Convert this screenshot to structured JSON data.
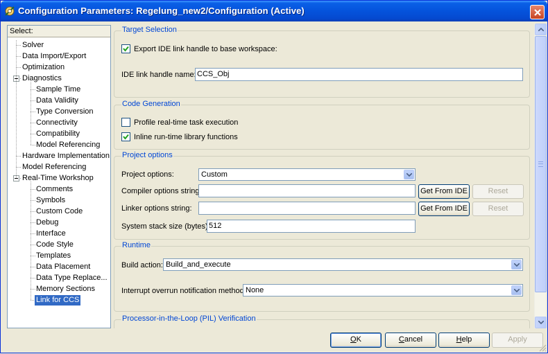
{
  "window": {
    "title": "Configuration Parameters: Regelung_new2/Configuration (Active)"
  },
  "tree": {
    "header": "Select:",
    "items": [
      {
        "label": "Solver",
        "level": 0
      },
      {
        "label": "Data Import/Export",
        "level": 0
      },
      {
        "label": "Optimization",
        "level": 0
      },
      {
        "label": "Diagnostics",
        "level": 0,
        "expanded": true
      },
      {
        "label": "Sample Time",
        "level": 1
      },
      {
        "label": "Data Validity",
        "level": 1
      },
      {
        "label": "Type Conversion",
        "level": 1
      },
      {
        "label": "Connectivity",
        "level": 1
      },
      {
        "label": "Compatibility",
        "level": 1
      },
      {
        "label": "Model Referencing",
        "level": 1
      },
      {
        "label": "Hardware Implementation",
        "level": 0
      },
      {
        "label": "Model Referencing",
        "level": 0
      },
      {
        "label": "Real-Time Workshop",
        "level": 0,
        "expanded": true
      },
      {
        "label": "Comments",
        "level": 1
      },
      {
        "label": "Symbols",
        "level": 1
      },
      {
        "label": "Custom Code",
        "level": 1
      },
      {
        "label": "Debug",
        "level": 1
      },
      {
        "label": "Interface",
        "level": 1
      },
      {
        "label": "Code Style",
        "level": 1
      },
      {
        "label": "Templates",
        "level": 1
      },
      {
        "label": "Data Placement",
        "level": 1
      },
      {
        "label": "Data Type Replace...",
        "level": 1
      },
      {
        "label": "Memory Sections",
        "level": 1
      },
      {
        "label": "Link for CCS",
        "level": 1,
        "selected": true
      }
    ]
  },
  "target_selection": {
    "title": "Target Selection",
    "export_checkbox_label": "Export IDE link handle to base workspace:",
    "export_checked": true,
    "handle_name_label": "IDE link handle name:",
    "handle_name_value": "CCS_Obj"
  },
  "code_generation": {
    "title": "Code Generation",
    "profile_label": "Profile real-time task execution",
    "profile_checked": false,
    "inline_label": "Inline run-time library functions",
    "inline_checked": true
  },
  "project_options": {
    "title": "Project options",
    "project_options_label": "Project options:",
    "project_options_value": "Custom",
    "compiler_label": "Compiler options string:",
    "compiler_value": "",
    "linker_label": "Linker options string:",
    "linker_value": "",
    "get_from_ide_label": "Get From IDE",
    "reset_label": "Reset",
    "stack_label": "System stack size (bytes):",
    "stack_value": "512"
  },
  "runtime": {
    "title": "Runtime",
    "build_action_label": "Build action:",
    "build_action_value": "Build_and_execute",
    "interrupt_label": "Interrupt overrun notification method:",
    "interrupt_value": "None"
  },
  "pil": {
    "title": "Processor-in-the-Loop (PIL) Verification"
  },
  "buttons": {
    "ok_key": "O",
    "ok_rest": "K",
    "cancel_key": "C",
    "cancel_rest": "ancel",
    "help_key": "H",
    "help_rest": "elp",
    "apply": "Apply"
  },
  "colors": {
    "accent": "#0046d5",
    "selection": "#316ac5",
    "titlebar": "#0553dc"
  },
  "icons": [
    "matlab-config-icon",
    "close-icon",
    "checkmark-icon",
    "chevron-down-icon",
    "scroll-up-icon",
    "scroll-down-icon"
  ]
}
